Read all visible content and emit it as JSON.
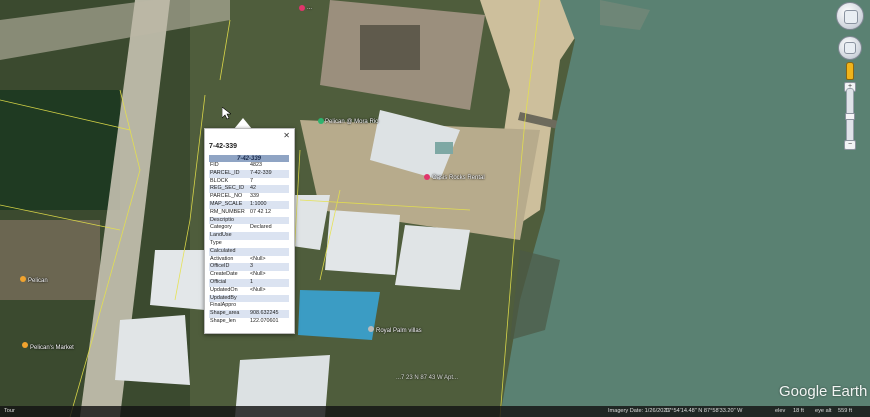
{
  "window": {
    "app": "Google Earth"
  },
  "popup": {
    "title": "7-42-339",
    "table_header": "7-42-339",
    "rows": [
      {
        "k": "FID",
        "v": "4823"
      },
      {
        "k": "PARCEL_ID",
        "v": "7-42-339"
      },
      {
        "k": "BLOCK",
        "v": "7"
      },
      {
        "k": "REG_SEC_ID",
        "v": "42"
      },
      {
        "k": "PARCEL_NO",
        "v": "339"
      },
      {
        "k": "MAP_SCALE",
        "v": "1:1000"
      },
      {
        "k": "RM_NUMBER",
        "v": "07 42 12"
      },
      {
        "k": "Descriptio",
        "v": ""
      },
      {
        "k": "Category",
        "v": "Declared"
      },
      {
        "k": "LandUse",
        "v": ""
      },
      {
        "k": "Type",
        "v": ""
      },
      {
        "k": "Calculated",
        "v": ""
      },
      {
        "k": "Activation",
        "v": "<Null>"
      },
      {
        "k": "OfficeID",
        "v": "3"
      },
      {
        "k": "CreateDate",
        "v": "<Null>"
      },
      {
        "k": "Official",
        "v": "1"
      },
      {
        "k": "UpdatedOn",
        "v": "<Null>"
      },
      {
        "k": "UpdatedBy",
        "v": ""
      },
      {
        "k": "FinalAppro",
        "v": ""
      },
      {
        "k": "Shape_area",
        "v": "908.632245"
      },
      {
        "k": "Shape_len",
        "v": "122.070601"
      }
    ]
  },
  "places": {
    "top": "...",
    "pelican_margaritas": "Pelican @ Mora Rio",
    "rocks_rental": "Oasis Rocks Rental",
    "royal_palm": "Royal Palm villas",
    "left_shop": "Pelican",
    "left_market": "Pelican's Market",
    "bottom_road": "...7 23 N 87 43 W Apt..."
  },
  "status": {
    "left": "Tour",
    "imagery_date": "Imagery Date: 1/26/2021",
    "coords": "17°54'14.48\" N  87°58'33.20\" W",
    "elev_label": "elev",
    "elev_value": "18 ft",
    "eye_label": "eye alt",
    "eye_value": "559 ft"
  },
  "controls": {
    "zoom_in": "+",
    "zoom_out": "−"
  },
  "brand": "Google Earth",
  "colors": {
    "sea": "#5a8172",
    "land": "#4f5d3c",
    "sand": "#cdbf9c",
    "pool": "#3b9cc4",
    "parcel_line": "#e6e24a",
    "pin_red": "#e0356b",
    "pin_orange": "#f0a32e",
    "pin_green": "#2fb36f"
  }
}
